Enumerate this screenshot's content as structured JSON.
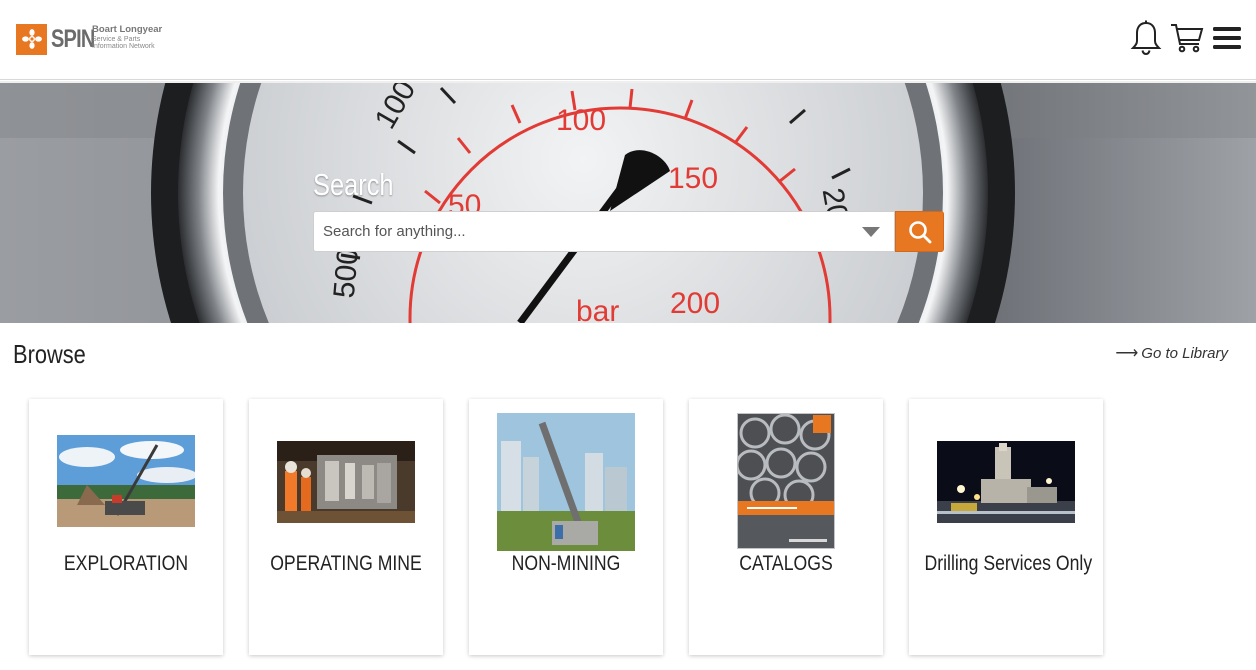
{
  "header": {
    "logo_word": "SPIN",
    "logo_company": "Boart Longyear",
    "logo_tagline_1": "Service & Parts",
    "logo_tagline_2": "Information Network",
    "notifications_icon": "bell-icon",
    "cart_icon": "cart-icon",
    "menu_icon": "hamburger-menu-icon"
  },
  "hero": {
    "search_title": "Search",
    "search_placeholder": "Search for anything...",
    "search_button_icon": "search-icon",
    "accent": "#e87722"
  },
  "browse": {
    "title": "Browse",
    "library_link": "Go to Library",
    "cards": [
      {
        "label": "EXPLORATION",
        "image": "exploration-rig-photo"
      },
      {
        "label": "OPERATING MINE",
        "image": "mine-workers-photo"
      },
      {
        "label": "NON-MINING",
        "image": "urban-drill-photo"
      },
      {
        "label": "CATALOGS",
        "image": "catalog-cover-photo"
      },
      {
        "label": "Drilling Services Only",
        "image": "night-rig-photo"
      }
    ]
  }
}
